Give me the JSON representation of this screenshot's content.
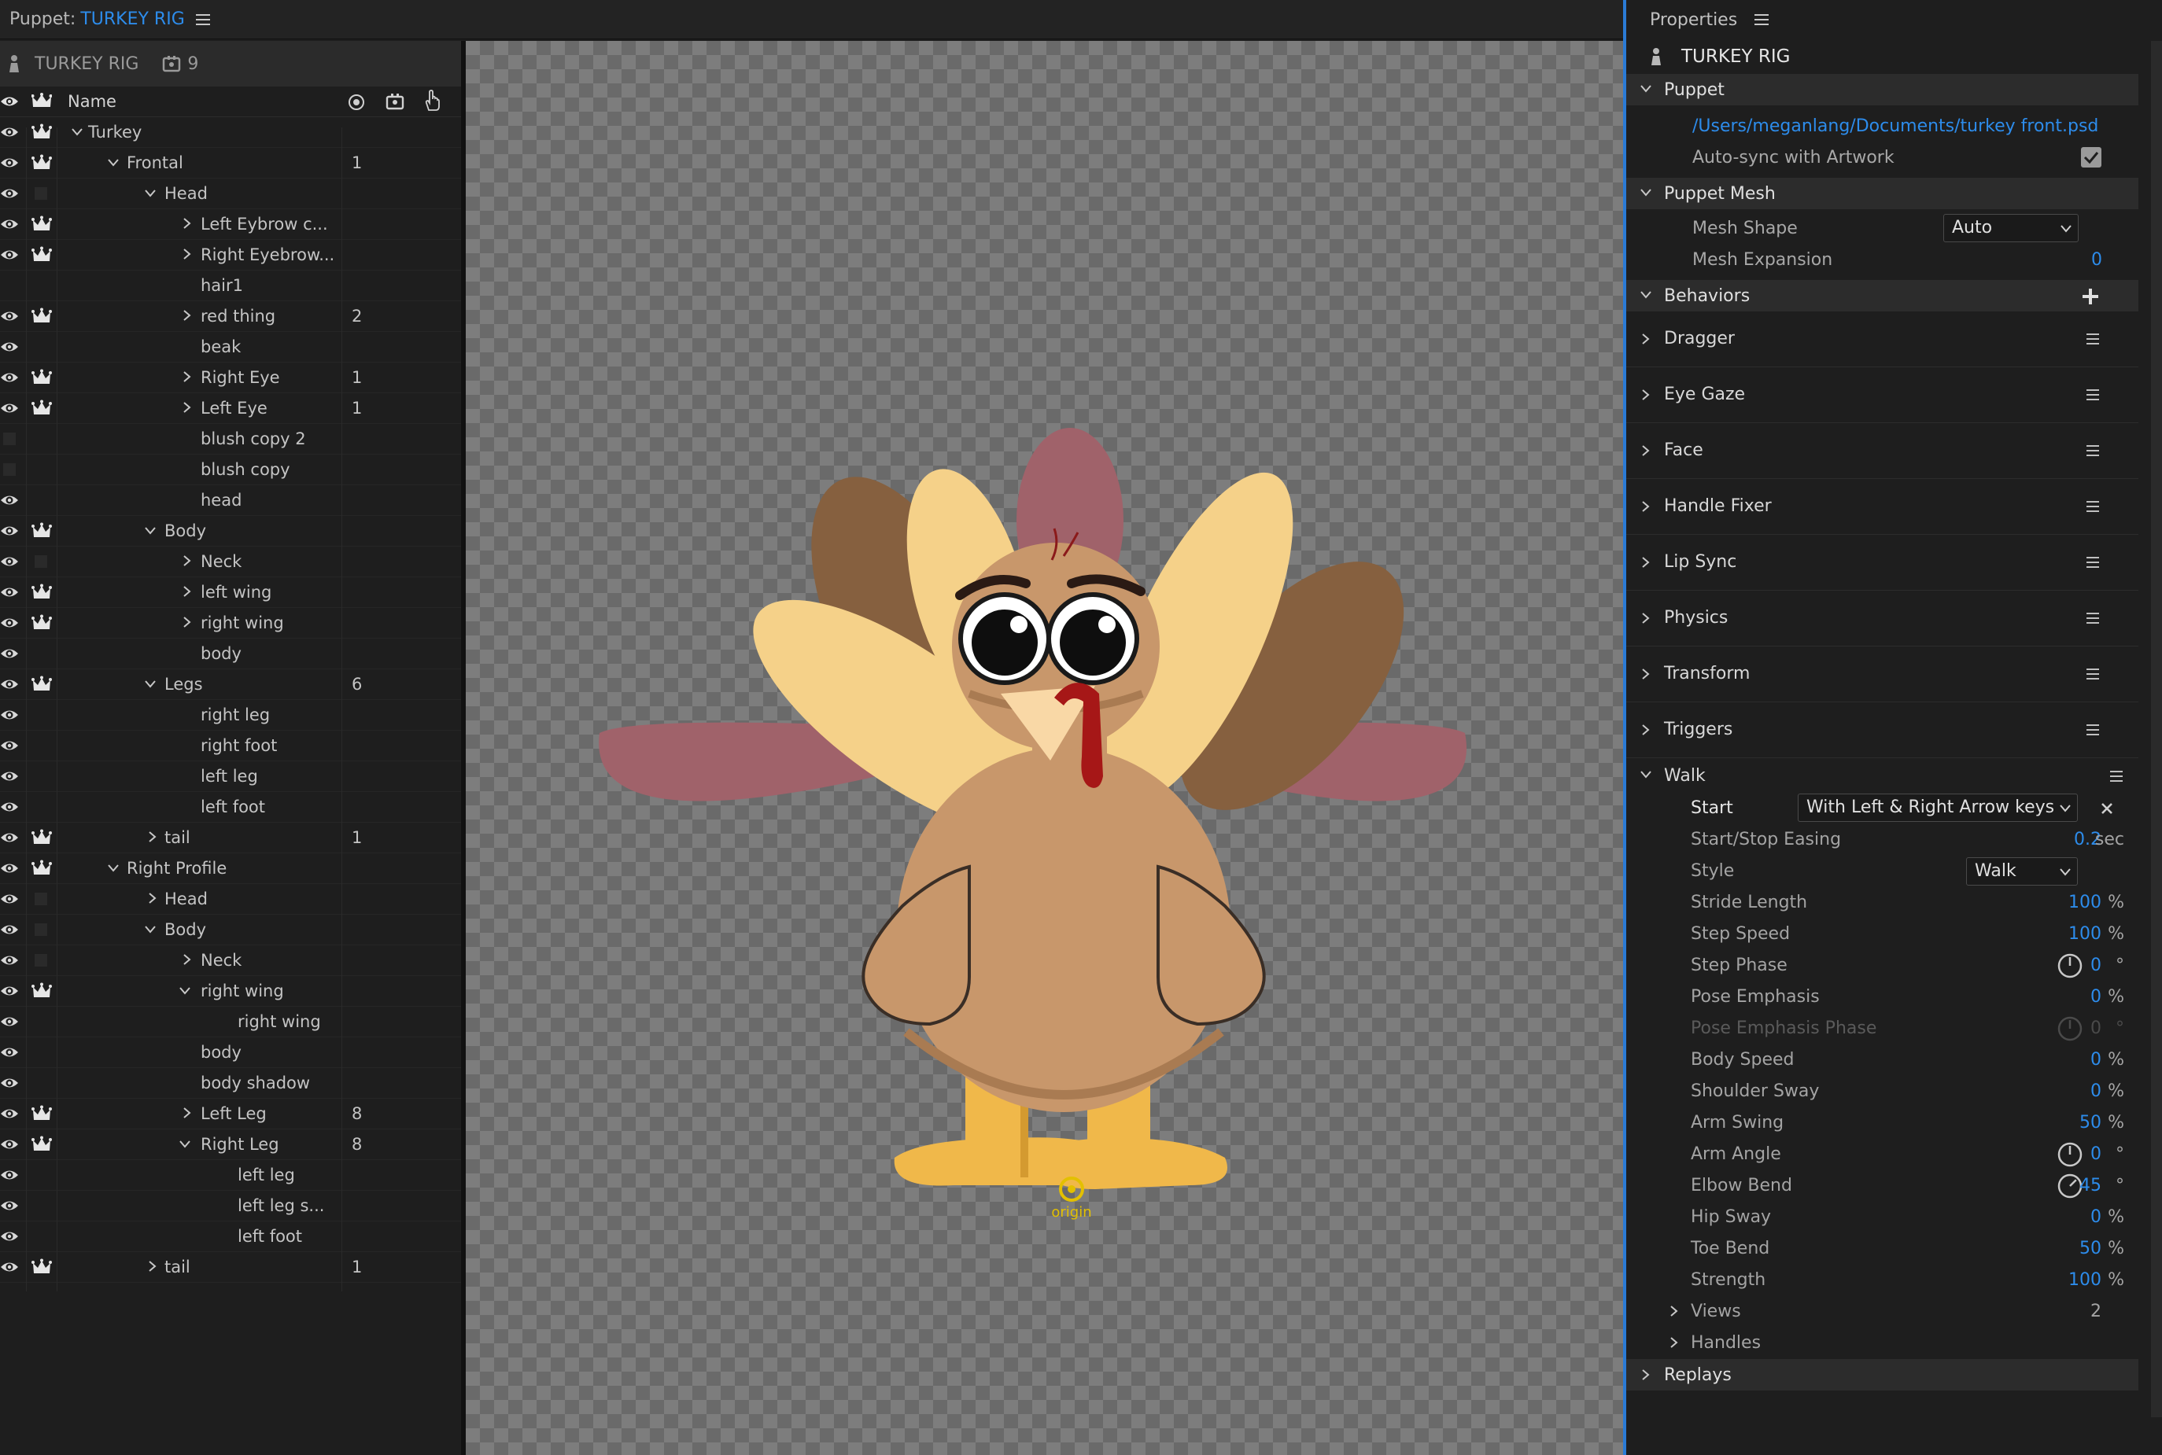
{
  "topbar": {
    "label": "Puppet:",
    "rig_name": "TURKEY RIG"
  },
  "puppet_panel": {
    "header_title": "TURKEY RIG",
    "header_count": "9",
    "column_name": "Name",
    "rows": [
      {
        "name": "Turkey",
        "indent": 1,
        "chev": "down",
        "eye": true,
        "crown": true,
        "count": ""
      },
      {
        "name": "Frontal",
        "indent": 2,
        "chev": "down",
        "eye": true,
        "crown": true,
        "count": "1"
      },
      {
        "name": "Head",
        "indent": 3,
        "chev": "down",
        "eye": true,
        "crown": false,
        "box": true,
        "count": ""
      },
      {
        "name": "Left Eybrow c...",
        "indent": 4,
        "chev": "right",
        "eye": true,
        "crown": true,
        "count": ""
      },
      {
        "name": "Right Eyebrow...",
        "indent": 4,
        "chev": "right",
        "eye": true,
        "crown": true,
        "count": ""
      },
      {
        "name": "hair1",
        "indent": 4,
        "chev": "",
        "eye": false,
        "crown": false,
        "count": ""
      },
      {
        "name": "red thing",
        "indent": 4,
        "chev": "right",
        "eye": true,
        "crown": true,
        "count": "2"
      },
      {
        "name": "beak",
        "indent": 4,
        "chev": "",
        "eye": true,
        "crown": false,
        "count": ""
      },
      {
        "name": "Right Eye",
        "indent": 4,
        "chev": "right",
        "eye": true,
        "crown": true,
        "count": "1"
      },
      {
        "name": "Left Eye",
        "indent": 4,
        "chev": "right",
        "eye": true,
        "crown": true,
        "count": "1"
      },
      {
        "name": "blush copy 2",
        "indent": 4,
        "chev": "",
        "eye": false,
        "box0": true,
        "crown": false,
        "count": ""
      },
      {
        "name": "blush copy",
        "indent": 4,
        "chev": "",
        "eye": false,
        "box0": true,
        "crown": false,
        "count": ""
      },
      {
        "name": "head",
        "indent": 4,
        "chev": "",
        "eye": true,
        "crown": false,
        "count": ""
      },
      {
        "name": "Body",
        "indent": 3,
        "chev": "down",
        "eye": true,
        "crown": true,
        "count": ""
      },
      {
        "name": "Neck",
        "indent": 4,
        "chev": "right",
        "eye": true,
        "crown": false,
        "box": true,
        "count": ""
      },
      {
        "name": "left wing",
        "indent": 4,
        "chev": "right",
        "eye": true,
        "crown": true,
        "count": ""
      },
      {
        "name": "right wing",
        "indent": 4,
        "chev": "right",
        "eye": true,
        "crown": true,
        "count": ""
      },
      {
        "name": "body",
        "indent": 4,
        "chev": "",
        "eye": true,
        "crown": false,
        "count": ""
      },
      {
        "name": "Legs",
        "indent": 3,
        "chev": "down",
        "eye": true,
        "crown": true,
        "count": "6"
      },
      {
        "name": "right leg",
        "indent": 4,
        "chev": "",
        "eye": true,
        "crown": false,
        "count": ""
      },
      {
        "name": "right foot",
        "indent": 4,
        "chev": "",
        "eye": true,
        "crown": false,
        "count": ""
      },
      {
        "name": "left leg",
        "indent": 4,
        "chev": "",
        "eye": true,
        "crown": false,
        "count": ""
      },
      {
        "name": "left foot",
        "indent": 4,
        "chev": "",
        "eye": true,
        "crown": false,
        "count": ""
      },
      {
        "name": "tail",
        "indent": 3,
        "chev": "right",
        "eye": true,
        "crown": true,
        "count": "1"
      },
      {
        "name": "Right Profile",
        "indent": 2,
        "chev": "down",
        "eye": true,
        "crown": true,
        "count": ""
      },
      {
        "name": "Head",
        "indent": 3,
        "chev": "right",
        "eye": true,
        "crown": false,
        "box": true,
        "count": ""
      },
      {
        "name": "Body",
        "indent": 3,
        "chev": "down",
        "eye": true,
        "crown": false,
        "box": true,
        "count": ""
      },
      {
        "name": "Neck",
        "indent": 4,
        "chev": "right",
        "eye": true,
        "crown": false,
        "box": true,
        "count": ""
      },
      {
        "name": "right wing",
        "indent": 4,
        "chev": "down",
        "eye": true,
        "crown": true,
        "count": ""
      },
      {
        "name": "right wing",
        "indent": 5,
        "chev": "",
        "eye": true,
        "crown": false,
        "count": ""
      },
      {
        "name": "body",
        "indent": 4,
        "chev": "",
        "eye": true,
        "crown": false,
        "count": ""
      },
      {
        "name": "body shadow",
        "indent": 4,
        "chev": "",
        "eye": true,
        "crown": false,
        "count": ""
      },
      {
        "name": "Left Leg",
        "indent": 4,
        "chev": "right",
        "eye": true,
        "crown": true,
        "count": "8"
      },
      {
        "name": "Right Leg",
        "indent": 4,
        "chev": "down",
        "eye": true,
        "crown": true,
        "count": "8"
      },
      {
        "name": "left leg",
        "indent": 5,
        "chev": "",
        "eye": true,
        "crown": false,
        "count": ""
      },
      {
        "name": "left leg s...",
        "indent": 5,
        "chev": "",
        "eye": true,
        "crown": false,
        "count": ""
      },
      {
        "name": "left foot",
        "indent": 5,
        "chev": "",
        "eye": true,
        "crown": false,
        "count": ""
      },
      {
        "name": "tail",
        "indent": 3,
        "chev": "right",
        "eye": true,
        "crown": true,
        "count": "1"
      }
    ]
  },
  "canvas": {
    "origin_label": "origin"
  },
  "properties": {
    "title": "Properties",
    "rig_name": "TURKEY RIG",
    "puppet_section": "Puppet",
    "file_path": "/Users/meganlang/Documents/turkey front.psd",
    "auto_sync_label": "Auto-sync with Artwork",
    "auto_sync_checked": true,
    "mesh_section": "Puppet Mesh",
    "mesh_shape_label": "Mesh Shape",
    "mesh_shape_value": "Auto",
    "mesh_expansion_label": "Mesh Expansion",
    "mesh_expansion_value": "0",
    "behaviors_section": "Behaviors",
    "behaviors": [
      "Dragger",
      "Eye Gaze",
      "Face",
      "Handle Fixer",
      "Lip Sync",
      "Physics",
      "Transform",
      "Triggers"
    ],
    "walk": {
      "title": "Walk",
      "start_label": "Start",
      "start_value": "With Left & Right Arrow keys",
      "style_label": "Style",
      "style_value": "Walk",
      "params": [
        {
          "label": "Start/Stop Easing",
          "value": "0.2",
          "unit": "sec"
        },
        {
          "label": "Stride Length",
          "value": "100",
          "unit": "%"
        },
        {
          "label": "Step Speed",
          "value": "100",
          "unit": "%"
        },
        {
          "label": "Step Phase",
          "value": "0",
          "unit": "°",
          "knob": true
        },
        {
          "label": "Pose Emphasis",
          "value": "0",
          "unit": "%"
        },
        {
          "label": "Pose Emphasis Phase",
          "value": "0",
          "unit": "°",
          "knob": true,
          "disabled": true
        },
        {
          "label": "Body Speed",
          "value": "0",
          "unit": "%"
        },
        {
          "label": "Shoulder Sway",
          "value": "0",
          "unit": "%"
        },
        {
          "label": "Arm Swing",
          "value": "50",
          "unit": "%"
        },
        {
          "label": "Arm Angle",
          "value": "0",
          "unit": "°",
          "knob": true
        },
        {
          "label": "Elbow Bend",
          "value": "45",
          "unit": "°",
          "knob": true
        },
        {
          "label": "Hip Sway",
          "value": "0",
          "unit": "%"
        },
        {
          "label": "Toe Bend",
          "value": "50",
          "unit": "%"
        },
        {
          "label": "Strength",
          "value": "100",
          "unit": "%"
        }
      ],
      "views_label": "Views",
      "views_count": "2",
      "handles_label": "Handles"
    },
    "replays_section": "Replays"
  },
  "colors": {
    "accent": "#2d8ceb",
    "panel": "#1e1e1e",
    "section": "#2c2c2c"
  }
}
